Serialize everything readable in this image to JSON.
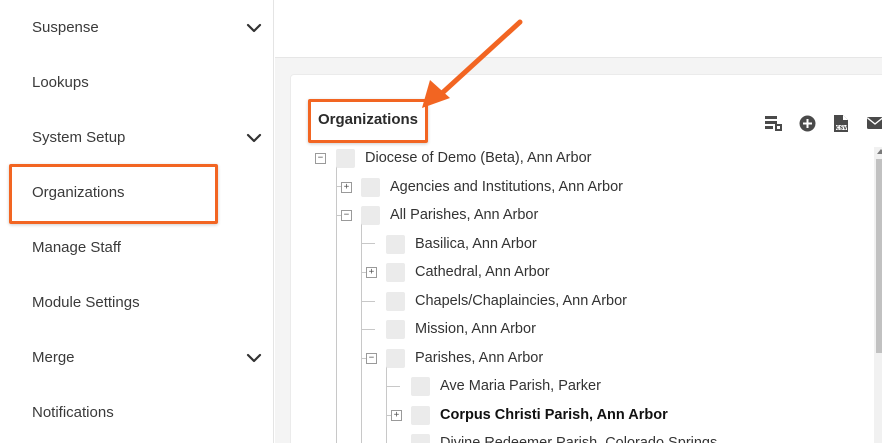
{
  "sidebar": {
    "items": [
      {
        "label": "Suspense",
        "has_chevron": true
      },
      {
        "label": "Lookups",
        "has_chevron": false
      },
      {
        "label": "System Setup",
        "has_chevron": true
      },
      {
        "label": "Organizations",
        "has_chevron": false,
        "highlighted": true
      },
      {
        "label": "Manage Staff",
        "has_chevron": false
      },
      {
        "label": "Module Settings",
        "has_chevron": false
      },
      {
        "label": "Merge",
        "has_chevron": true
      },
      {
        "label": "Notifications",
        "has_chevron": false
      }
    ]
  },
  "panel": {
    "title": "Organizations",
    "toolbar": [
      {
        "icon": "org-chart-icon"
      },
      {
        "icon": "add-circle-icon"
      },
      {
        "icon": "csv-file-icon"
      },
      {
        "icon": "envelope-icon"
      }
    ]
  },
  "tree": {
    "rows": [
      {
        "label": "Diocese of Demo (Beta), Ann Arbor",
        "level": 0,
        "toggle": "minus",
        "bold": false
      },
      {
        "label": "Agencies and Institutions, Ann Arbor",
        "level": 1,
        "toggle": "plus",
        "bold": false
      },
      {
        "label": "All Parishes, Ann Arbor",
        "level": 1,
        "toggle": "minus",
        "bold": false
      },
      {
        "label": "Basilica, Ann Arbor",
        "level": 2,
        "toggle": "none",
        "bold": false
      },
      {
        "label": "Cathedral, Ann Arbor",
        "level": 2,
        "toggle": "plus",
        "bold": false
      },
      {
        "label": "Chapels/Chaplaincies, Ann Arbor",
        "level": 2,
        "toggle": "none",
        "bold": false
      },
      {
        "label": "Mission, Ann Arbor",
        "level": 2,
        "toggle": "none",
        "bold": false
      },
      {
        "label": "Parishes, Ann Arbor",
        "level": 2,
        "toggle": "minus",
        "bold": false
      },
      {
        "label": "Ave Maria Parish, Parker",
        "level": 3,
        "toggle": "none",
        "bold": false
      },
      {
        "label": "Corpus Christi Parish, Ann Arbor",
        "level": 3,
        "toggle": "plus",
        "bold": true
      },
      {
        "label": "Divine Redeemer Parish, Colorado Springs",
        "level": 3,
        "toggle": "none",
        "bold": false
      }
    ]
  },
  "colors": {
    "highlight": "#f26522",
    "panel_bg": "#f4f4f4",
    "icon": "#4a4a4a"
  }
}
